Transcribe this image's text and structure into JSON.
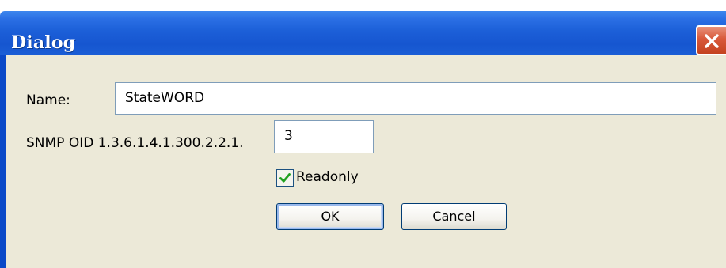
{
  "window": {
    "title": "Dialog",
    "close_icon": "close-icon"
  },
  "form": {
    "name_label": "Name:",
    "name_value": "StateWORD",
    "oid_label": "SNMP OID 1.3.6.1.4.1.300.2.2.1.",
    "oid_value": "3",
    "readonly_label": "Readonly",
    "readonly_checked": true
  },
  "buttons": {
    "ok_label": "OK",
    "cancel_label": "Cancel"
  },
  "colors": {
    "titlebar": "#1656d0",
    "client_background": "#ece9d8",
    "close_button": "#d8583a",
    "checkmark": "#21a121"
  }
}
